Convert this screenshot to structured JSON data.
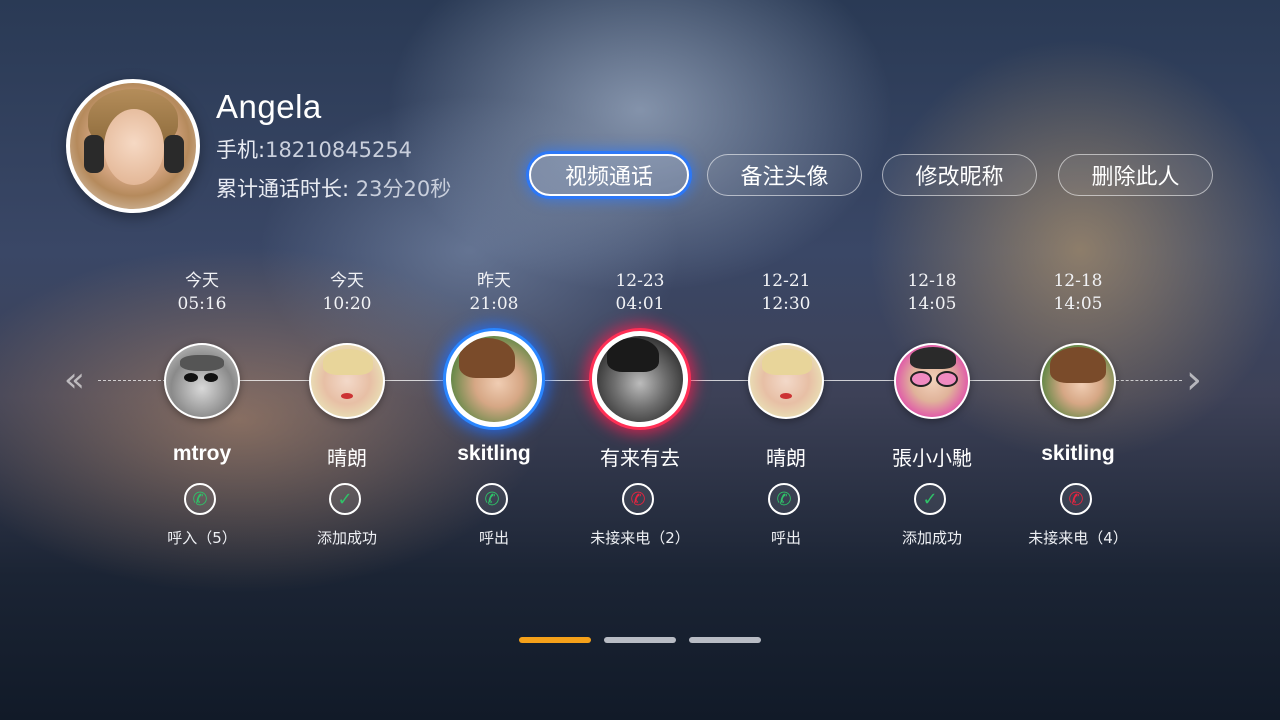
{
  "contact": {
    "name": "Angela",
    "phone_label": "手机:",
    "phone": "18210845254",
    "duration_label": "累计通话时长: ",
    "duration": "23分20秒"
  },
  "actions": [
    {
      "label": "视频通话",
      "active": true
    },
    {
      "label": "备注头像",
      "active": false
    },
    {
      "label": "修改昵称",
      "active": false
    },
    {
      "label": "删除此人",
      "active": false
    }
  ],
  "nav": {
    "prev_icon": "chevron-left-icon",
    "next_icon": "chevron-right-icon",
    "prev": "«",
    "next": "›"
  },
  "calls": [
    {
      "date": "今天",
      "time": "05:16",
      "name": "mtroy",
      "status": "呼入（5）",
      "status_icon": "incoming-call-icon",
      "ring": "none"
    },
    {
      "date": "今天",
      "time": "10:20",
      "name": "晴朗",
      "status": "添加成功",
      "status_icon": "check-icon",
      "ring": "none"
    },
    {
      "date": "昨天",
      "time": "21:08",
      "name": "skitling",
      "status": "呼出",
      "status_icon": "outgoing-call-icon",
      "ring": "blue"
    },
    {
      "date": "12-23",
      "time": "04:01",
      "name": "有来有去",
      "status": "未接来电（2）",
      "status_icon": "missed-call-icon",
      "ring": "red"
    },
    {
      "date": "12-21",
      "time": "12:30",
      "name": "晴朗",
      "status": "呼出",
      "status_icon": "outgoing-call-icon",
      "ring": "none"
    },
    {
      "date": "12-18",
      "time": "14:05",
      "name": "張小小馳",
      "status": "添加成功",
      "status_icon": "check-icon",
      "ring": "none"
    },
    {
      "date": "12-18",
      "time": "14:05",
      "name": "skitling",
      "status": "未接来电（4）",
      "status_icon": "missed-call-icon",
      "ring": "none"
    }
  ],
  "pager": {
    "pages": 3,
    "current": 1
  },
  "colors": {
    "accent_blue": "#2a86ff",
    "missed_red": "#e8243f",
    "ok_green": "#2fc268",
    "pager_active": "#f5a11a"
  }
}
